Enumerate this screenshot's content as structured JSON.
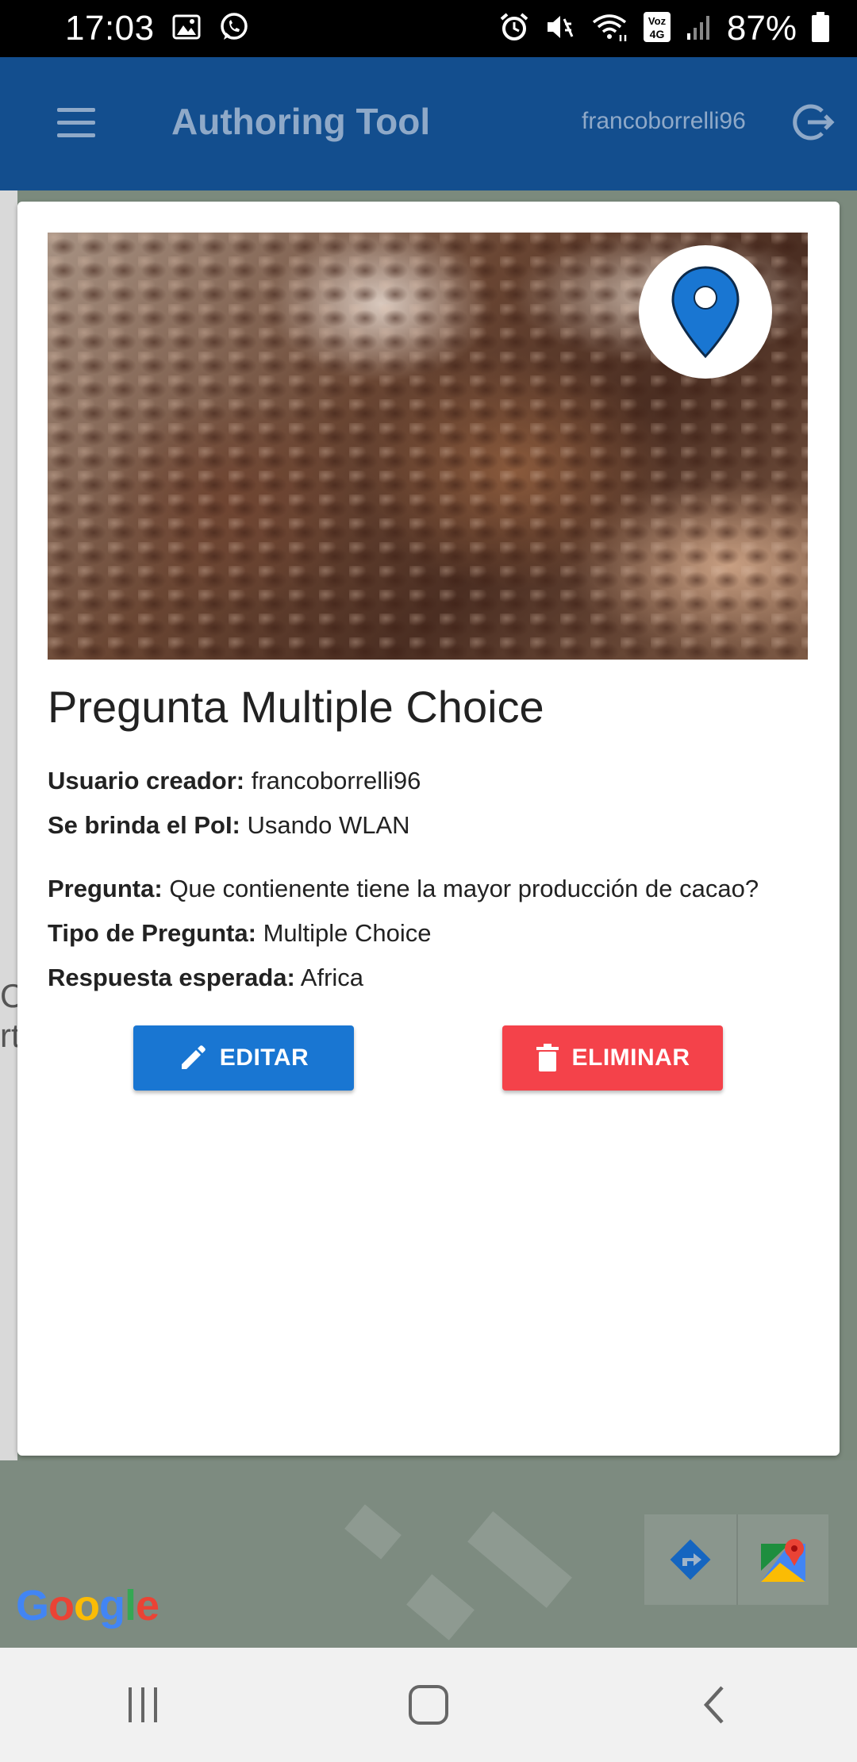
{
  "status_bar": {
    "time": "17:03",
    "battery": "87%",
    "icons": [
      "gallery-icon",
      "whatsapp-icon",
      "alarm-icon",
      "mute-icon",
      "wifi-icon",
      "volte-icon",
      "signal-icon",
      "battery-icon"
    ],
    "volte_label_top": "Voz",
    "volte_label_bottom": "4G"
  },
  "app_bar": {
    "title": "Authoring Tool",
    "username": "francoborrelli96",
    "menu_icon": "menu-icon",
    "logout_icon": "logout-icon",
    "color": "#134e8e"
  },
  "card": {
    "image": "cocoa-beans-photo",
    "location_icon": "location-pin-icon",
    "title": "Pregunta Multiple Choice",
    "fields": [
      {
        "label": "Usuario creador:",
        "value": "francoborrelli96"
      },
      {
        "label": "Se brinda el PoI:",
        "value": "Usando WLAN"
      },
      {
        "label": "Pregunta:",
        "value": "Que contienente tiene la mayor producción de cacao?"
      },
      {
        "label": "Tipo de Pregunta:",
        "value": "Multiple Choice"
      },
      {
        "label": "Respuesta esperada:",
        "value": "Africa"
      }
    ],
    "edit_button": {
      "label": "EDITAR",
      "icon": "pencil-icon",
      "color": "#1976d2"
    },
    "delete_button": {
      "label": "ELIMINAR",
      "icon": "trash-icon",
      "color": "#f4424a"
    }
  },
  "map": {
    "side_text_1": "Ca",
    "side_text_2": "rt",
    "google_logo": "Google",
    "directions_icon": "directions-icon",
    "maps_app_icon": "google-maps-icon"
  },
  "system_nav": {
    "icons": [
      "recents-icon",
      "home-icon",
      "back-icon"
    ]
  }
}
